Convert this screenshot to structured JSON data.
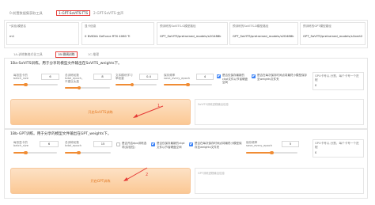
{
  "top_tabs": [
    {
      "label": "0-前置数据集获取工具"
    },
    {
      "label": "1-GPT-SoVITS-TTS"
    },
    {
      "label": "2-GPT-SoVITS-变声"
    }
  ],
  "experiment": {
    "name_label": "*实验/模型名",
    "name_value": "m1",
    "gpu_label": "显卡信息",
    "gpu_value": "0  NVIDIA GeForce RTX 4060 Ti",
    "pretrained_s2g_label": "预训练的SoVITS-G模型路径",
    "pretrained_s2g_value": "GPT_SoVITS/pretrained_models/s2G488k",
    "pretrained_s2d_label": "预训练的SoVITS-D模型路径",
    "pretrained_s2d_value": "GPT_SoVITS/pretrained_models/s2D488k",
    "pretrained_gpt_label": "预训练的GPT模型路径",
    "pretrained_gpt_value": "GPT_SoVITS/pretrained_models/s1bert2"
  },
  "sub_tabs": [
    {
      "label": "1A-训练集格式化工具"
    },
    {
      "label": "1B-微调训练"
    },
    {
      "label": "1C-推理"
    }
  ],
  "sovits": {
    "title": "1Ba-SoVITS训练。用于分享的模型文件输出在SoVITS_weights下。",
    "batch_label": "每张显卡的\nbatch_size",
    "batch_value": "6",
    "batch_fraction": 0.28,
    "epoch_label": "总训练轮数\ntotal_epoch，\n不建议太高",
    "epoch_value": "8",
    "epoch_fraction": 0.32,
    "lr_label": "文本模块学习\n率权重",
    "lr_value": "0.4",
    "lr_fraction": 0.4,
    "save_label": "保存频率\nsave_every_epoch",
    "save_value": "4",
    "save_fraction": 0.5,
    "check1": "是否仅保存最新的ckpt文件以节省硬盘空间",
    "check1_on": true,
    "check2": "是否在每次保存时间点将最终小模型保存至weights文件夹",
    "check2_on": true,
    "gpu_hint": "GPU卡号以-分割，每个卡号一个进程",
    "gpu_value": "0",
    "button": "开启SoVITS训练",
    "output_label": "SoVITS训练进程输出信息"
  },
  "gpt": {
    "title": "1Bb-GPT训练。用于分享的模型文件输出在GPT_weights下。",
    "batch_label": "每张显卡的\nbatch_size",
    "batch_value": "6",
    "batch_fraction": 0.28,
    "epoch_label": "总训练轮数\ntotal_epoch",
    "epoch_value": "15",
    "epoch_fraction": 0.3,
    "dpo_label": "是否开启dpo训练选项(实验性)",
    "dpo_on": false,
    "check1": "是否仅保存最新的ckpt文件以节省硬盘空间",
    "check1_on": true,
    "check2": "是否在每次保存时间点将最终小模型保存至weights文件夹",
    "check2_on": true,
    "save_label": "保存频率\nsave_every_epoch",
    "save_value": "5",
    "save_fraction": 0.5,
    "gpu_hint": "GPU卡号以-分割，每个卡号一个进程",
    "gpu_value": "0",
    "button": "开启GPT训练",
    "output_label": "GPT训练进程输出信息"
  },
  "annotations": [
    {
      "label": "1"
    },
    {
      "label": "2"
    }
  ],
  "colors": {
    "accent": "#f08c34",
    "annotation": "#e53935",
    "checkbox": "#3b82f6"
  }
}
